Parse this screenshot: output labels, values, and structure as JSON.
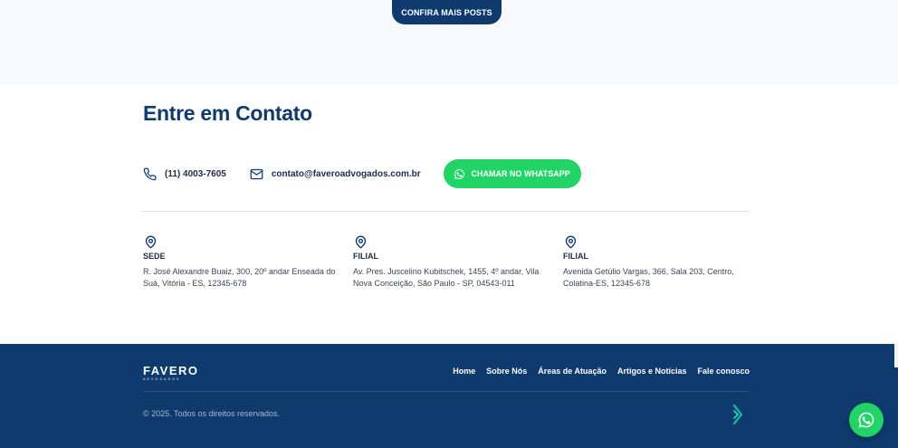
{
  "cta": {
    "label": "CONFIRA MAIS POSTS"
  },
  "contact": {
    "title": "Entre em Contato",
    "phone": "(11) 4003-7605",
    "email": "contato@faveroadvogados.com.br",
    "whatsapp_label": "CHAMAR NO WHATSAPP"
  },
  "offices": [
    {
      "title": "SEDE",
      "address": "R. José Alexandre Buaiz, 300, 20º andar Enseada do Suá, Vitória - ES, 12345-678"
    },
    {
      "title": "FILIAL",
      "address": "Av. Pres. Juscelino Kubitschek, 1455, 4º andar, Vila Nova Conceição, São Paulo - SP, 04543-011"
    },
    {
      "title": "FILIAL",
      "address": "Avenida Getúlio Vargas, 366, Sala 203, Centro, Colatina-ES, 12345-678"
    }
  ],
  "footer": {
    "logo_main": "FAVERO",
    "logo_sub": "ADVOGADOS",
    "nav": [
      "Home",
      "Sobre Nós",
      "Áreas de Atuação",
      "Artigos e Notícias",
      "Fale conosco"
    ],
    "copyright": "© 2025. Todos os direitos reservados."
  },
  "colors": {
    "navy": "#0e3a6e",
    "whatsapp": "#22d366",
    "dev_logo": "#19b3a0"
  },
  "icons": {
    "phone": "phone-icon",
    "email": "mail-icon",
    "whatsapp": "whatsapp-icon",
    "pin": "map-pin-icon",
    "dev_logo": "developer-logo-icon"
  }
}
